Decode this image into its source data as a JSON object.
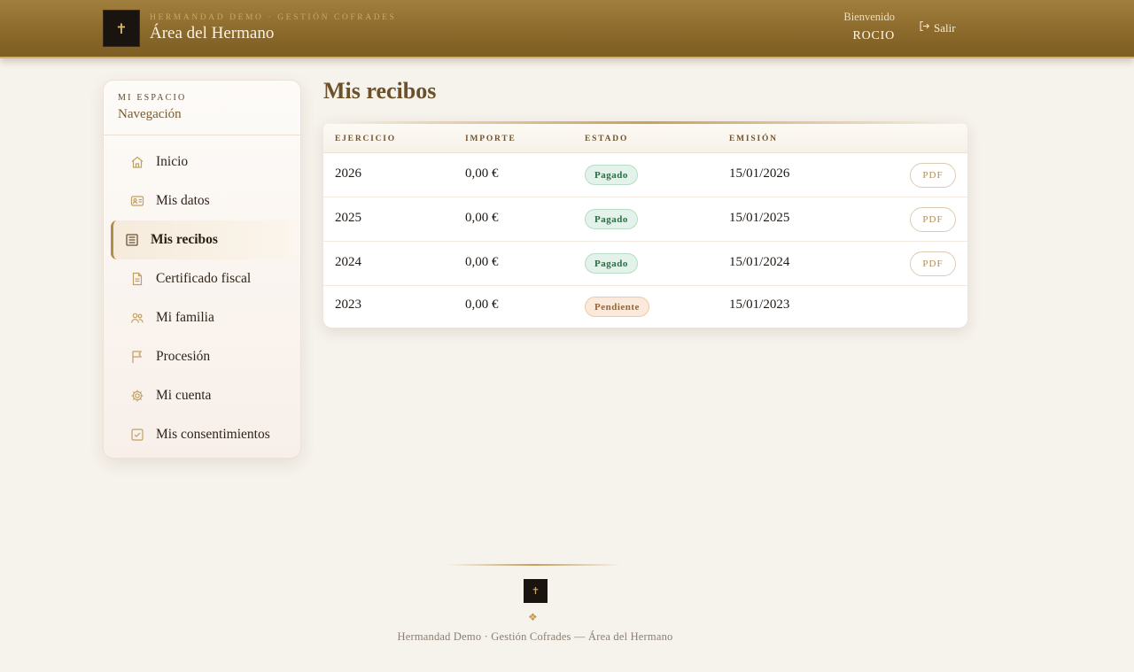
{
  "header": {
    "kicker": "HERMANDAD DEMO · GESTIÓN COFRADES",
    "title": "Área del Hermano",
    "welcome_label": "Bienvenido",
    "user_name": "ROCIO",
    "logout_label": "Salir",
    "logout_icon": "logout-icon",
    "logo_icon": "brotherhood-crest-logo"
  },
  "sidebar": {
    "kicker": "MI ESPACIO",
    "title": "Navegación",
    "items": [
      {
        "label": "Inicio",
        "icon": "home-icon"
      },
      {
        "label": "Mis datos",
        "icon": "id-card-icon"
      },
      {
        "label": "Mis recibos",
        "icon": "receipt-icon",
        "active": true
      },
      {
        "label": "Certificado fiscal",
        "icon": "document-icon"
      },
      {
        "label": "Mi familia",
        "icon": "family-icon"
      },
      {
        "label": "Procesión",
        "icon": "flag-icon"
      },
      {
        "label": "Mi cuenta",
        "icon": "gear-icon"
      },
      {
        "label": "Mis consentimientos",
        "icon": "checkbox-icon"
      }
    ]
  },
  "main": {
    "title": "Mis recibos",
    "table": {
      "headers": [
        "EJERCICIO",
        "IMPORTE",
        "ESTADO",
        "EMISIÓN"
      ],
      "rows": [
        {
          "year": "2026",
          "amount": "0,00 €",
          "status": "Pagado",
          "status_kind": "paid",
          "date": "15/01/2026",
          "pdf": "PDF"
        },
        {
          "year": "2025",
          "amount": "0,00 €",
          "status": "Pagado",
          "status_kind": "paid",
          "date": "15/01/2025",
          "pdf": "PDF"
        },
        {
          "year": "2024",
          "amount": "0,00 €",
          "status": "Pagado",
          "status_kind": "paid",
          "date": "15/01/2024",
          "pdf": "PDF"
        },
        {
          "year": "2023",
          "amount": "0,00 €",
          "status": "Pendiente",
          "status_kind": "pending",
          "date": "15/01/2023",
          "pdf": ""
        }
      ]
    }
  },
  "footer": {
    "ornament": "❖",
    "text": "Hermandad Demo · Gestión Cofrades — Área del Hermano"
  },
  "colors": {
    "header_gold": "#8c6a2c",
    "accent_gold": "#c6a25c",
    "page_bg": "#f6f2ec",
    "paid_green": "#2e6a45",
    "pending_orange": "#9a6530"
  }
}
